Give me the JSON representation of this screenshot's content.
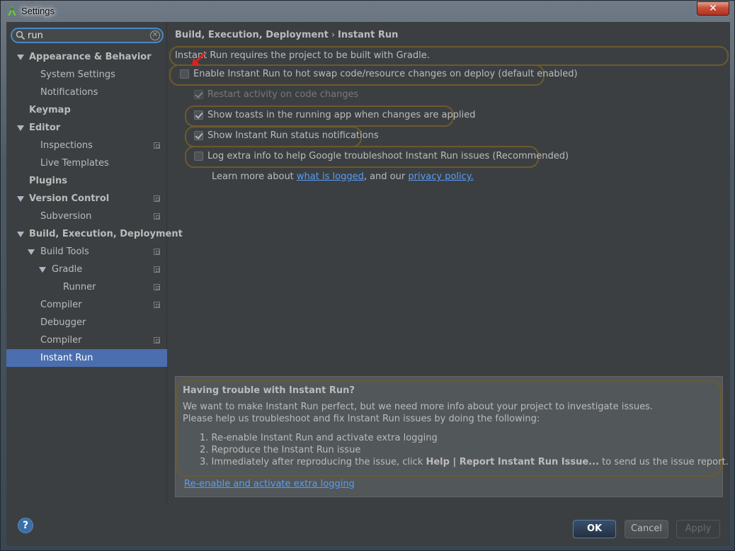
{
  "window": {
    "title": "Settings",
    "close_glyph": "✕"
  },
  "search": {
    "value": "run",
    "clear_glyph": "✕"
  },
  "sidebar": {
    "items": [
      {
        "label": "Appearance & Behavior"
      },
      {
        "label": "System Settings"
      },
      {
        "label": "Notifications"
      },
      {
        "label": "Keymap"
      },
      {
        "label": "Editor"
      },
      {
        "label": "Inspections"
      },
      {
        "label": "Live Templates"
      },
      {
        "label": "Plugins"
      },
      {
        "label": "Version Control"
      },
      {
        "label": "Subversion"
      },
      {
        "label": "Build, Execution, Deployment"
      },
      {
        "label": "Build Tools"
      },
      {
        "label": "Gradle"
      },
      {
        "label": "Runner"
      },
      {
        "label": "Compiler"
      },
      {
        "label": "Debugger"
      },
      {
        "label": "Compiler"
      },
      {
        "label": "Instant Run"
      }
    ]
  },
  "content": {
    "breadcrumb_parent": "Build, Execution, Deployment",
    "breadcrumb_sep": "›",
    "breadcrumb_current": "Instant Run",
    "gradle_note": "Instant Run requires the project to be built with Gradle.",
    "options": {
      "enable": {
        "label": "Enable Instant Run to hot swap code/resource changes on deploy (default enabled)",
        "checked": false
      },
      "restart": {
        "label": "Restart activity on code changes",
        "checked": true,
        "enabled": false
      },
      "toasts": {
        "label": "Show toasts in the running app when changes are applied",
        "checked": true
      },
      "status": {
        "label": "Show Instant Run status notifications",
        "checked": true
      },
      "log": {
        "label": "Log extra info to help Google troubleshoot Instant Run issues (Recommended)",
        "checked": false
      }
    },
    "learn_prefix": "Learn more about ",
    "learn_link1": "what is logged",
    "learn_mid": ", and our ",
    "learn_link2": "privacy policy."
  },
  "help_panel": {
    "title": "Having trouble with Instant Run?",
    "line1": "We want to make Instant Run perfect, but we need more info about your project to investigate issues.",
    "line2": "Please help us troubleshoot and fix Instant Run issues by doing the following:",
    "step1": "1. Re-enable Instant Run and activate extra logging",
    "step2": "2. Reproduce the Instant Run issue",
    "step3_prefix": "3. Immediately after reproducing the issue, click ",
    "step3_bold": "Help | Report Instant Run Issue...",
    "step3_suffix": " to send us the issue report.",
    "link": "Re-enable and activate extra logging"
  },
  "buttons": {
    "help": "?",
    "ok": "OK",
    "cancel": "Cancel",
    "apply": "Apply"
  },
  "colors": {
    "selection": "#4b6eaf",
    "link": "#589df6",
    "highlight_outline": "#6b5a2d",
    "annotation_arrow": "#e02020"
  }
}
